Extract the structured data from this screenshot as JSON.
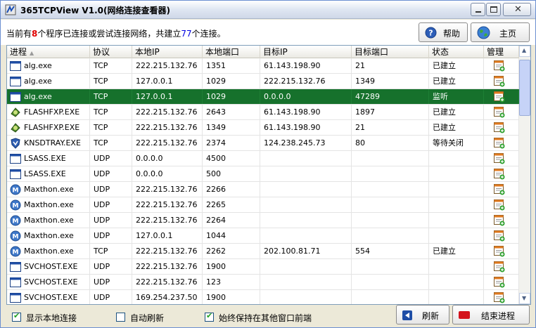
{
  "window": {
    "title": "365TCPView V1.0(网络连接查看器)"
  },
  "info": {
    "prefix": "当前有",
    "program_count": "8",
    "middle": "个程序已连接或尝试连接网络，共建立",
    "connection_count": "77",
    "suffix": "个连接。"
  },
  "toolbar": {
    "help_label": "帮助",
    "home_label": "主页"
  },
  "table": {
    "headers": {
      "process": "进程",
      "protocol": "协议",
      "local_ip": "本地IP",
      "local_port": "本地端口",
      "remote_ip": "目标IP",
      "remote_port": "目标端口",
      "status": "状态",
      "manage": "管理"
    },
    "rows": [
      {
        "process": "alg.exe",
        "icon": "window-icon",
        "protocol": "TCP",
        "local_ip": "222.215.132.76",
        "local_port": "1351",
        "remote_ip": "61.143.198.90",
        "remote_port": "21",
        "status": "已建立"
      },
      {
        "process": "alg.exe",
        "icon": "window-icon",
        "protocol": "TCP",
        "local_ip": "127.0.0.1",
        "local_port": "1029",
        "remote_ip": "222.215.132.76",
        "remote_port": "1349",
        "status": "已建立"
      },
      {
        "process": "alg.exe",
        "icon": "window-icon",
        "protocol": "TCP",
        "local_ip": "127.0.0.1",
        "local_port": "1029",
        "remote_ip": "0.0.0.0",
        "remote_port": "47289",
        "status": "监听"
      },
      {
        "process": "FLASHFXP.EXE",
        "icon": "flashfxp-icon",
        "protocol": "TCP",
        "local_ip": "222.215.132.76",
        "local_port": "2643",
        "remote_ip": "61.143.198.90",
        "remote_port": "1897",
        "status": "已建立"
      },
      {
        "process": "FLASHFXP.EXE",
        "icon": "flashfxp-icon",
        "protocol": "TCP",
        "local_ip": "222.215.132.76",
        "local_port": "1349",
        "remote_ip": "61.143.198.90",
        "remote_port": "21",
        "status": "已建立"
      },
      {
        "process": "KNSDTRAY.EXE",
        "icon": "shield-icon",
        "protocol": "TCP",
        "local_ip": "222.215.132.76",
        "local_port": "2374",
        "remote_ip": "124.238.245.73",
        "remote_port": "80",
        "status": "等待关闭"
      },
      {
        "process": "LSASS.EXE",
        "icon": "window-icon",
        "protocol": "UDP",
        "local_ip": "0.0.0.0",
        "local_port": "4500",
        "remote_ip": "",
        "remote_port": "",
        "status": ""
      },
      {
        "process": "LSASS.EXE",
        "icon": "window-icon",
        "protocol": "UDP",
        "local_ip": "0.0.0.0",
        "local_port": "500",
        "remote_ip": "",
        "remote_port": "",
        "status": ""
      },
      {
        "process": "Maxthon.exe",
        "icon": "maxthon-icon",
        "protocol": "UDP",
        "local_ip": "222.215.132.76",
        "local_port": "2266",
        "remote_ip": "",
        "remote_port": "",
        "status": ""
      },
      {
        "process": "Maxthon.exe",
        "icon": "maxthon-icon",
        "protocol": "UDP",
        "local_ip": "222.215.132.76",
        "local_port": "2265",
        "remote_ip": "",
        "remote_port": "",
        "status": ""
      },
      {
        "process": "Maxthon.exe",
        "icon": "maxthon-icon",
        "protocol": "UDP",
        "local_ip": "222.215.132.76",
        "local_port": "2264",
        "remote_ip": "",
        "remote_port": "",
        "status": ""
      },
      {
        "process": "Maxthon.exe",
        "icon": "maxthon-icon",
        "protocol": "UDP",
        "local_ip": "127.0.0.1",
        "local_port": "1044",
        "remote_ip": "",
        "remote_port": "",
        "status": ""
      },
      {
        "process": "Maxthon.exe",
        "icon": "maxthon-icon",
        "protocol": "TCP",
        "local_ip": "222.215.132.76",
        "local_port": "2262",
        "remote_ip": "202.100.81.71",
        "remote_port": "554",
        "status": "已建立"
      },
      {
        "process": "SVCHOST.EXE",
        "icon": "window-icon",
        "protocol": "UDP",
        "local_ip": "222.215.132.76",
        "local_port": "1900",
        "remote_ip": "",
        "remote_port": "",
        "status": ""
      },
      {
        "process": "SVCHOST.EXE",
        "icon": "window-icon",
        "protocol": "UDP",
        "local_ip": "222.215.132.76",
        "local_port": "123",
        "remote_ip": "",
        "remote_port": "",
        "status": ""
      },
      {
        "process": "SVCHOST.EXE",
        "icon": "window-icon",
        "protocol": "UDP",
        "local_ip": "169.254.237.50",
        "local_port": "1900",
        "remote_ip": "",
        "remote_port": "",
        "status": ""
      }
    ],
    "selected_row": 2
  },
  "options": {
    "show_local_label": "显示本地连接",
    "show_local_checked": true,
    "auto_refresh_label": "自动刷新",
    "auto_refresh_checked": false,
    "always_on_top_label": "始终保持在其他窗口前端",
    "always_on_top_checked": true
  },
  "actions": {
    "refresh_label": "刷新",
    "kill_label": "结束进程"
  },
  "colors": {
    "selected_row": "#16712c",
    "program_count": "#e00000",
    "connection_count": "#0000e0"
  }
}
